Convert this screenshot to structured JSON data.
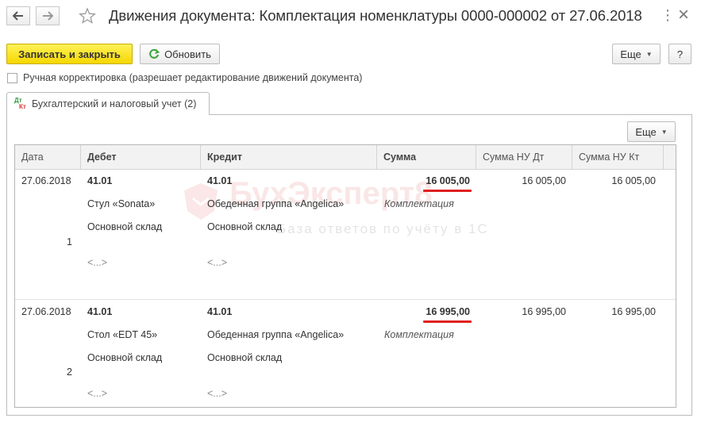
{
  "window": {
    "title": "Движения документа: Комплектация номенклатуры 0000-000002 от 27.06.2018",
    "back_icon": "arrow-left-icon",
    "forward_icon": "arrow-right-icon",
    "favorite_icon": "star-icon",
    "menu_glyph": "⋮",
    "close_glyph": "×"
  },
  "toolbar": {
    "save_close_label": "Записать и закрыть",
    "refresh_label": "Обновить",
    "more_label": "Еще",
    "help_label": "?"
  },
  "manual_edit": {
    "label": "Ручная корректировка (разрешает редактирование движений документа)",
    "checked": false
  },
  "tabs": [
    {
      "label": "Бухгалтерский и налоговый учет (2)",
      "icon_text_top": "Дт",
      "icon_text_bottom": "Кт"
    }
  ],
  "panel": {
    "more_label": "Еще"
  },
  "watermark": {
    "title": "БухЭксперт8",
    "subtitle": "База ответов по учёту в 1С"
  },
  "table": {
    "columns": [
      "Дата",
      "Дебет",
      "Кредит",
      "Сумма",
      "Сумма НУ Дт",
      "Сумма НУ Кт"
    ],
    "rows": [
      {
        "date": "27.06.2018",
        "line_no": "1",
        "debit_account": "41.01",
        "debit_sub1": "Стул «Sonata»",
        "debit_sub2": "Основной склад",
        "debit_sub3": "<...>",
        "credit_account": "41.01",
        "credit_sub1": "Обеденная группа «Angelica»",
        "credit_sub2": "Основной склад",
        "credit_sub3": "<...>",
        "amount": "16 005,00",
        "content": "Комплектация",
        "nu_dt": "16 005,00",
        "nu_kt": "16 005,00"
      },
      {
        "date": "27.06.2018",
        "line_no": "2",
        "debit_account": "41.01",
        "debit_sub1": "Стол «EDT 45»",
        "debit_sub2": "Основной склад",
        "debit_sub3": "<...>",
        "credit_account": "41.01",
        "credit_sub1": "Обеденная группа «Angelica»",
        "credit_sub2": "Основной склад",
        "credit_sub3": "<...>",
        "amount": "16 995,00",
        "content": "Комплектация",
        "nu_dt": "16 995,00",
        "nu_kt": "16 995,00"
      }
    ]
  },
  "colors": {
    "primary_button": "#f5d700",
    "highlight_underline": "#e01f1f",
    "refresh_icon": "#3aa53a"
  }
}
